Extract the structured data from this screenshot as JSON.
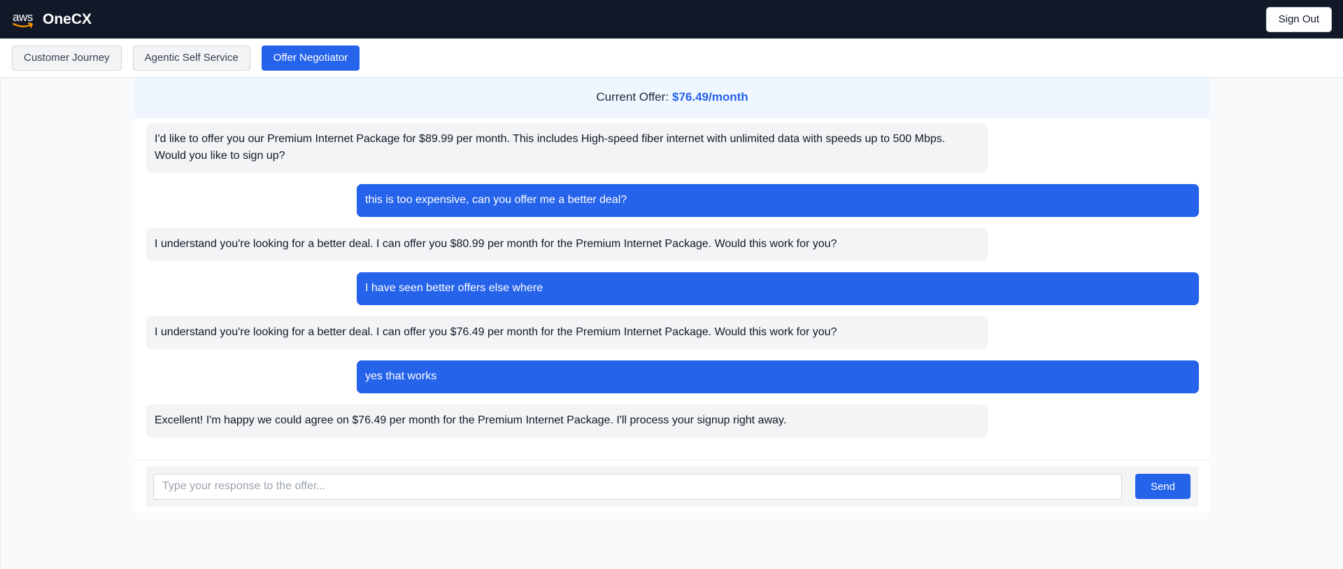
{
  "header": {
    "logo_text": "aws",
    "app_title": "OneCX",
    "sign_out_label": "Sign Out",
    "colors": {
      "background": "#111827",
      "logo_smile": "#ff9900"
    }
  },
  "tabs": [
    {
      "label": "Customer Journey",
      "active": false
    },
    {
      "label": "Agentic Self Service",
      "active": false
    },
    {
      "label": "Offer Negotiator",
      "active": true
    }
  ],
  "offer": {
    "label": "Current Offer:",
    "value": "$76.49/month"
  },
  "messages": [
    {
      "role": "bot",
      "text": "I'd like to offer you our Premium Internet Package for $89.99 per month. This includes High-speed fiber internet with unlimited data with speeds up to 500 Mbps. Would you like to sign up?"
    },
    {
      "role": "user",
      "text": "this is too expensive, can you offer me a better deal?"
    },
    {
      "role": "bot",
      "text": "I understand you're looking for a better deal. I can offer you $80.99 per month for the Premium Internet Package. Would this work for you?"
    },
    {
      "role": "user",
      "text": "I have seen better offers else where"
    },
    {
      "role": "bot",
      "text": "I understand you're looking for a better deal. I can offer you $76.49 per month for the Premium Internet Package. Would this work for you?"
    },
    {
      "role": "user",
      "text": "yes that works"
    },
    {
      "role": "bot",
      "text": "Excellent! I'm happy we could agree on $76.49 per month for the Premium Internet Package. I'll process your signup right away."
    }
  ],
  "composer": {
    "placeholder": "Type your response to the offer...",
    "value": "",
    "send_label": "Send"
  },
  "theme": {
    "accent": "#2563eb",
    "bot_bubble": "#f3f4f6",
    "offer_bar": "#eff6ff"
  }
}
